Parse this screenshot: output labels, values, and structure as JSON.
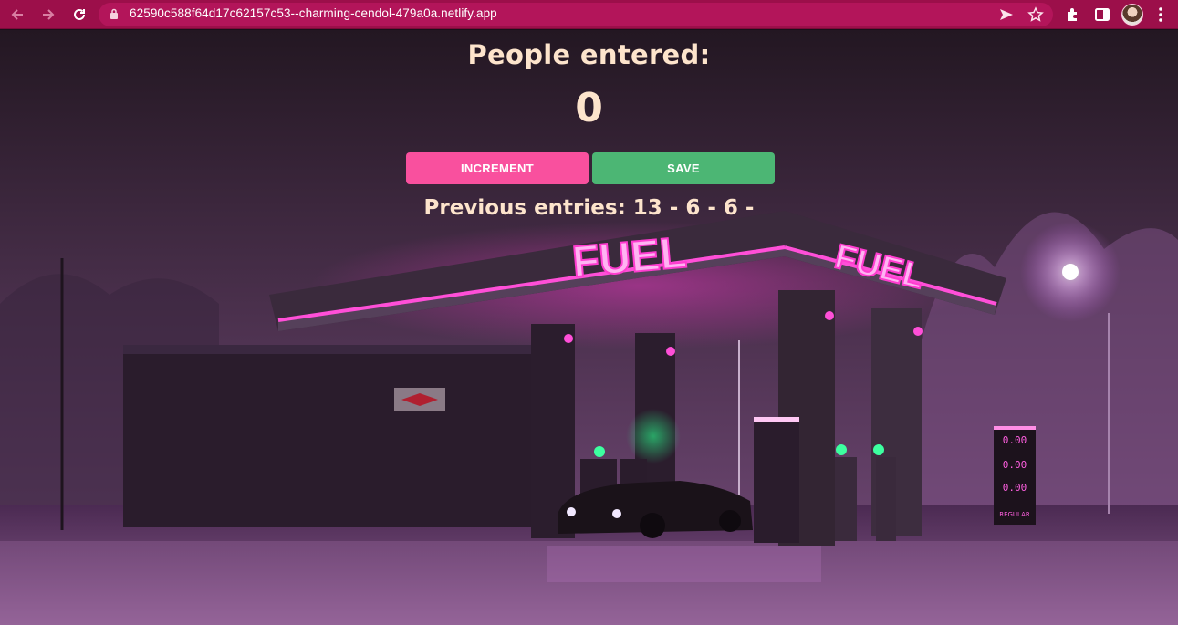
{
  "browser": {
    "url": "62590c588f64d17c62157c53--charming-cendol-479a0a.netlify.app",
    "icons": {
      "back": "arrow-left-icon",
      "forward": "arrow-right-icon",
      "reload": "reload-icon",
      "lock": "lock-icon",
      "send": "send-icon",
      "bookmark": "star-icon",
      "extensions": "puzzle-icon",
      "sidebar": "side-panel-icon",
      "menu": "kebab-menu-icon"
    },
    "colors": {
      "chrome": "#9c0f4a",
      "omnibox": "#b3155a"
    }
  },
  "app": {
    "heading": "People entered:",
    "count": "0",
    "increment_label": "INCREMENT",
    "save_label": "SAVE",
    "previous_entries": "Previous entries: 13 - 6 - 6 -",
    "colors": {
      "increment": "#f9509e",
      "save": "#4cb674",
      "text": "#fde4cc"
    }
  },
  "background": {
    "sign_text": "FUEL",
    "price_sign_text": "REGULAR"
  }
}
